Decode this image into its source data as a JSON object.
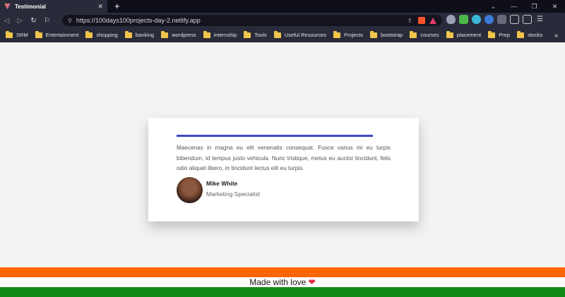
{
  "browser": {
    "tab_title": "Testimonial",
    "tab_close": "✕",
    "new_tab": "+",
    "url": "https://100days100projects-day-2.netlify.app",
    "window_controls": [
      "⌄",
      "—",
      "❐",
      "✕"
    ],
    "bookmarks": [
      "SRM",
      "Entertainment",
      "shopping",
      "banking",
      "wordpress",
      "internship",
      "Tools",
      "Useful Resources",
      "Projects",
      "bootstrap",
      "courses",
      "placement",
      "Prep",
      "stocks"
    ],
    "more_bookmarks": "»"
  },
  "testimonial": {
    "quote": "Maecenas in magna eu elit venenatis consequat. Fusce varius mi eu turpis bibendum, id tempus justo vehicula. Nunc tristique, metus eu auctor tincidunt, felis odio aliquet libero, in tincidunt lectus elit eu turpis.",
    "name": "Mike White",
    "role": "Marketing Specialist"
  },
  "footer": {
    "text": "Made with love",
    "heart": "❤"
  },
  "colors": {
    "accent_line": "#3f48c4",
    "saffron": "#ff6600",
    "white": "#ffffff",
    "green": "#118a13"
  }
}
